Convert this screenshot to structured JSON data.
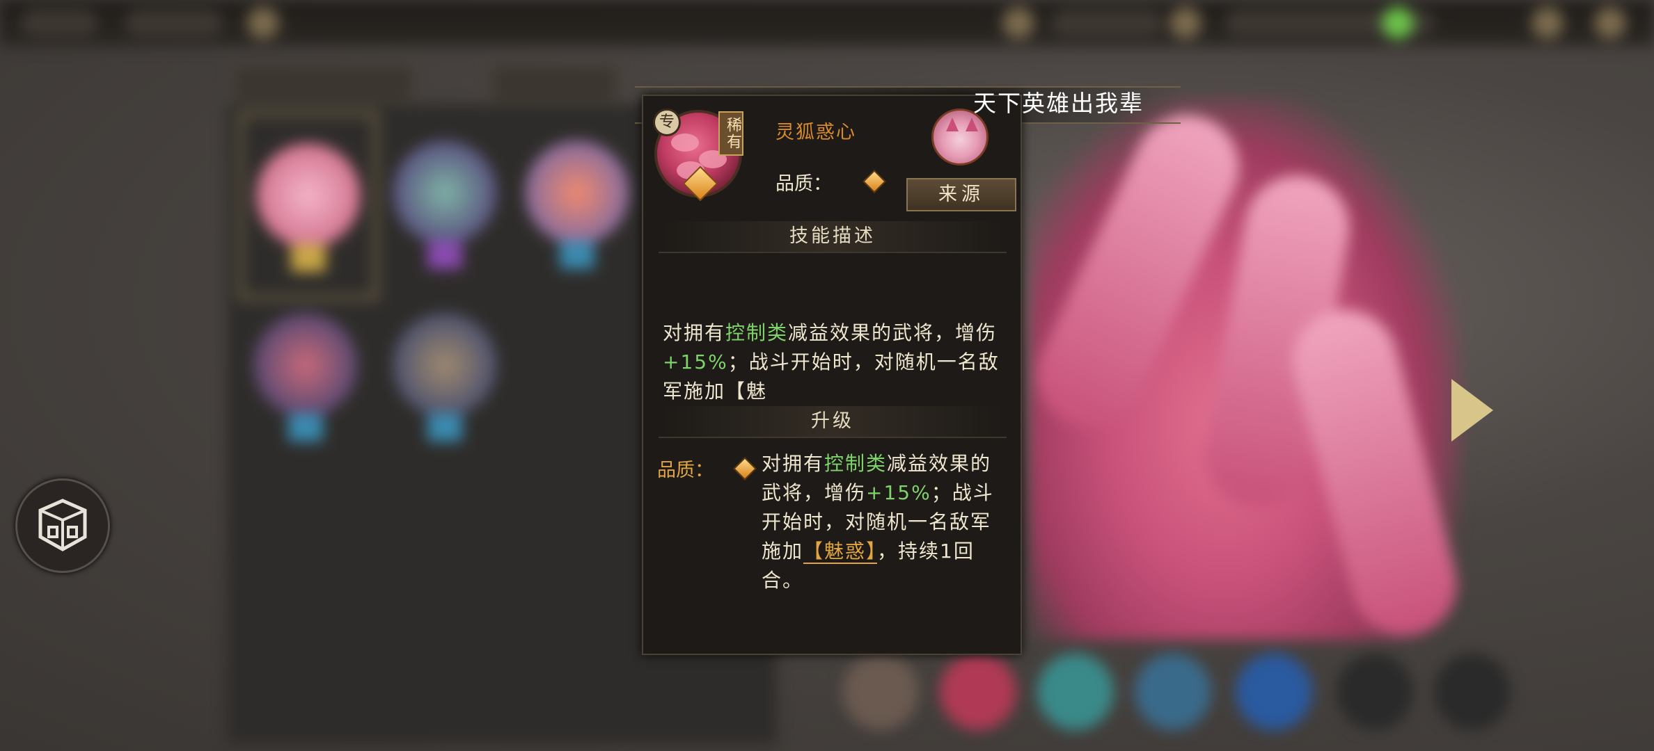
{
  "banner": {
    "text": "天下英雄出我辈"
  },
  "card": {
    "exclusive_badge": "专",
    "rarity_tag": "稀有",
    "skill_name": "灵狐惑心",
    "quality_label": "品质：",
    "source_button": "来源",
    "description_header": "技能描述",
    "description": {
      "part1": "对拥有",
      "keyword1": "控制类",
      "part2": "减益效果的武将，增伤",
      "value1": "+15%",
      "part3": "；战斗开始时，对随机一名敌军施加【魅"
    },
    "upgrade_header": "升级",
    "upgrade": {
      "quality_label": "品质：",
      "part1": "对拥有",
      "keyword1": "控制类",
      "part2": "减益效果的武将，增伤",
      "value1": "+15%",
      "part3": "；战斗开始时，对随机一名敌军施加",
      "effect": "【魅惑】",
      "part4": "，持续1回合。"
    }
  },
  "colors": {
    "highlight_green": "#7fd36b",
    "accent_gold": "#e3a540",
    "skill_name_orange": "#d98a2a"
  },
  "icons": {
    "side_button": "cube-emblem-icon",
    "quality_gem": "diamond-gem-icon"
  }
}
